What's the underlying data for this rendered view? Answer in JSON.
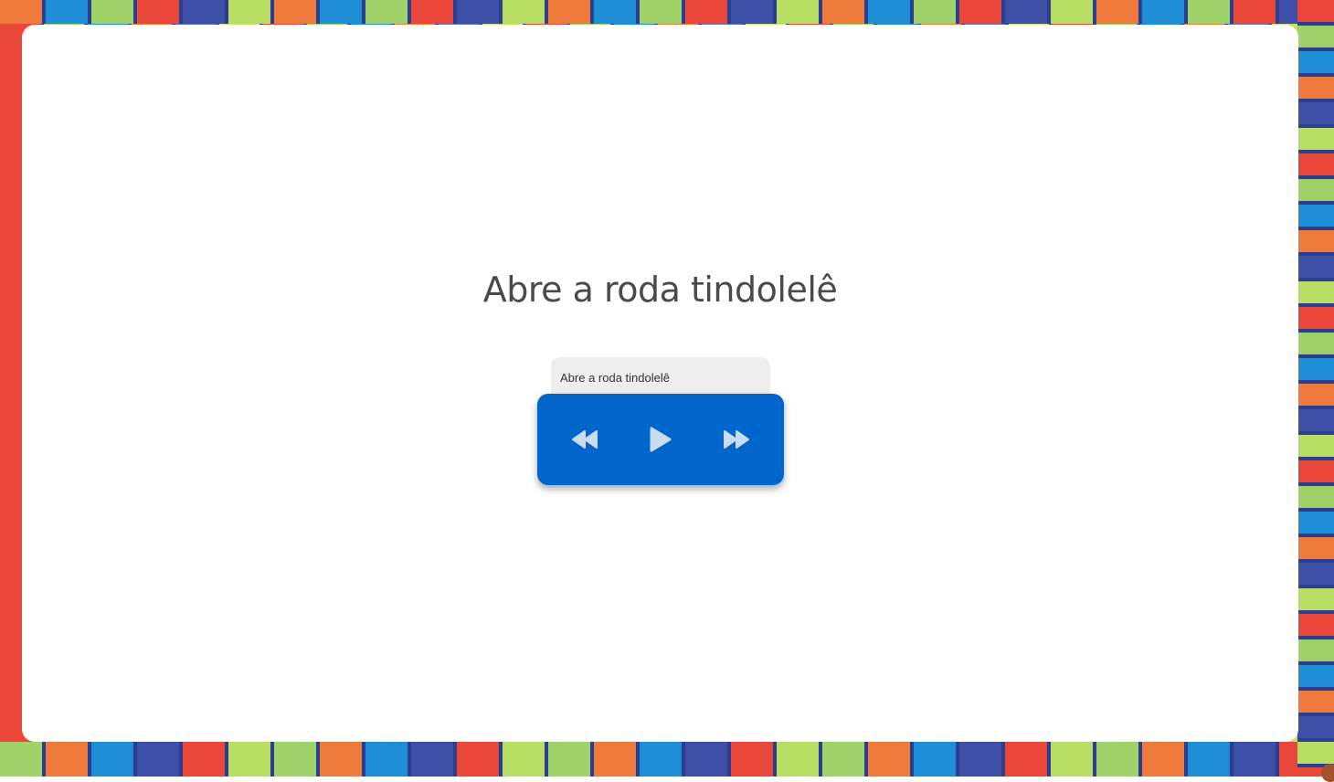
{
  "page": {
    "title": "Abre a roda tindolelê"
  },
  "player": {
    "track_label": "Abre a roda tindolelê",
    "controls": [
      {
        "name": "rewind",
        "icon": "rewind-icon"
      },
      {
        "name": "play",
        "icon": "play-icon"
      },
      {
        "name": "forward",
        "icon": "fast-forward-icon"
      }
    ],
    "accent_color": "#0066cc",
    "icon_color": "#c9dcf2"
  }
}
